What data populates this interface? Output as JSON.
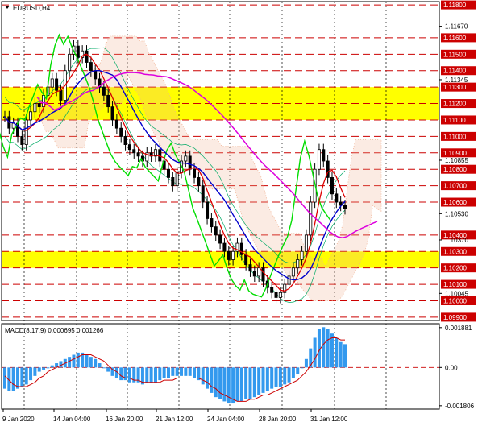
{
  "symbol_label": "EURUSD,H4",
  "macd_label": "MACD(8,17,9) 0.000695 0.001266",
  "colors": {
    "background": "#ffffff",
    "grid": "#000000",
    "price_bars": "#000000",
    "support_resistance": "#cc0000",
    "highlight_zone": "#ffff00",
    "ma_green": "#00dd00",
    "ma_blue": "#0000cc",
    "ma_red": "#dd0000",
    "ma_magenta": "#dd00dd",
    "envelope": "#00aa66",
    "cloud": "#f0b090",
    "macd_hist": "#3399ee",
    "macd_signal": "#cc0000",
    "label_bg": "#cc0000",
    "label_text": "#ffffff"
  },
  "chart_data": [
    {
      "type": "line",
      "title": "EURUSD,H4",
      "price_scale": [
        {
          "value": "1.11800",
          "boxed": true
        },
        {
          "value": "1.11670",
          "boxed": false
        },
        {
          "value": "1.11600",
          "boxed": true
        },
        {
          "value": "1.11500",
          "boxed": true
        },
        {
          "value": "1.11400",
          "boxed": true
        },
        {
          "value": "1.11345",
          "boxed": false
        },
        {
          "value": "1.11300",
          "boxed": true
        },
        {
          "value": "1.11200",
          "boxed": true
        },
        {
          "value": "1.11100",
          "boxed": true
        },
        {
          "value": "1.11000",
          "boxed": true
        },
        {
          "value": "1.10900",
          "boxed": true
        },
        {
          "value": "1.10855",
          "boxed": false
        },
        {
          "value": "1.10800",
          "boxed": true
        },
        {
          "value": "1.10700",
          "boxed": true
        },
        {
          "value": "1.10600",
          "boxed": true
        },
        {
          "value": "1.10530",
          "boxed": false
        },
        {
          "value": "1.10400",
          "boxed": true
        },
        {
          "value": "1.10370",
          "boxed": false
        },
        {
          "value": "1.10300",
          "boxed": true
        },
        {
          "value": "1.10200",
          "boxed": true
        },
        {
          "value": "1.10100",
          "boxed": true
        },
        {
          "value": "1.10045",
          "boxed": false
        },
        {
          "value": "1.10000",
          "boxed": true
        },
        {
          "value": "1.09900",
          "boxed": true
        }
      ],
      "ylim": [
        1.0988,
        1.1182
      ],
      "highlight_zones": [
        [
          1.111,
          1.113
        ],
        [
          1.102,
          1.103
        ]
      ],
      "x_categories": [
        "9 Jan 2020",
        "14 Jan 04:00",
        "16 Jan 20:00",
        "21 Jan 12:00",
        "24 Jan 04:00",
        "28 Jan 20:00",
        "31 Jan 12:00"
      ],
      "series": [
        {
          "values": [
            1.1112,
            1.1105,
            1.1108,
            1.11,
            1.1095,
            1.111,
            1.1115,
            1.112,
            1.1118,
            1.1125,
            1.113,
            1.1135,
            1.1128,
            1.1122,
            1.114,
            1.115,
            1.1155,
            1.1148,
            1.1152,
            1.1145,
            1.114,
            1.1135,
            1.113,
            1.1125,
            1.1118,
            1.111,
            1.1105,
            1.11,
            1.1095,
            1.1092,
            1.109,
            1.1088,
            1.1085,
            1.109,
            1.1088,
            1.1092,
            1.1085,
            1.108,
            1.1075,
            1.107,
            1.1078,
            1.1085,
            1.1088,
            1.108,
            1.1075,
            1.107,
            1.106,
            1.105,
            1.1045,
            1.104,
            1.1035,
            1.103,
            1.1025,
            1.103,
            1.1035,
            1.1028,
            1.1022,
            1.1018,
            1.1015,
            1.102,
            1.1012,
            1.1008,
            1.1005,
            1.1002,
            1.1005,
            1.101,
            1.1015,
            1.102,
            1.1025,
            1.103,
            1.104,
            1.106,
            1.108,
            1.1092,
            1.1085,
            1.1075,
            1.1065,
            1.106,
            1.1058,
            1.1056
          ]
        }
      ]
    },
    {
      "type": "bar",
      "title": "MACD(8,17,9) 0.000695 0.001266",
      "scale_labels": [
        "0.001881",
        "0.00",
        "-0.001806"
      ],
      "ylim": [
        -0.00185,
        0.00195
      ],
      "series": [
        {
          "values": [
            -0.001,
            -0.0011,
            -0.0011,
            -0.001,
            -0.0009,
            -0.0008,
            -0.0006,
            -0.0004,
            -0.0002,
            -0.0001,
            0.0,
            0.0001,
            0.0002,
            0.0003,
            0.0004,
            0.0005,
            0.0006,
            0.0007,
            0.0007,
            0.0006,
            0.0005,
            0.0004,
            0.0002,
            0.0,
            -0.0002,
            -0.0004,
            -0.0005,
            -0.0006,
            -0.0006,
            -0.0007,
            -0.0007,
            -0.0007,
            -0.0008,
            -0.0007,
            -0.0007,
            -0.0007,
            -0.0006,
            -0.0005,
            -0.0005,
            -0.0004,
            -0.0004,
            -0.0004,
            -0.0004,
            -0.0004,
            -0.0005,
            -0.0006,
            -0.0008,
            -0.001,
            -0.0012,
            -0.0014,
            -0.0015,
            -0.0016,
            -0.0017,
            -0.0017,
            -0.0016,
            -0.0016,
            -0.0015,
            -0.0015,
            -0.0014,
            -0.0013,
            -0.0012,
            -0.0011,
            -0.001,
            -0.0009,
            -0.0009,
            -0.0008,
            -0.0007,
            -0.0005,
            -0.0003,
            0.0,
            0.0004,
            0.0009,
            0.0014,
            0.0018,
            0.0019,
            0.0018,
            0.0016,
            0.0014,
            0.0012,
            0.0011
          ]
        },
        {
          "values": [
            -0.0004,
            -0.0006,
            -0.0008,
            -0.0009,
            -0.0009,
            -0.0009,
            -0.0008,
            -0.0007,
            -0.0005,
            -0.0004,
            -0.0002,
            -0.0001,
            0.0,
            0.0001,
            0.0002,
            0.0003,
            0.0004,
            0.0005,
            0.0006,
            0.0006,
            0.0006,
            0.0005,
            0.0004,
            0.0003,
            0.0001,
            -0.0001,
            -0.0002,
            -0.0004,
            -0.0005,
            -0.0005,
            -0.0006,
            -0.0006,
            -0.0007,
            -0.0007,
            -0.0007,
            -0.0007,
            -0.0007,
            -0.0006,
            -0.0006,
            -0.0006,
            -0.0005,
            -0.0005,
            -0.0005,
            -0.0005,
            -0.0005,
            -0.0005,
            -0.0006,
            -0.0007,
            -0.0009,
            -0.001,
            -0.0012,
            -0.0013,
            -0.0014,
            -0.0015,
            -0.0016,
            -0.0016,
            -0.0016,
            -0.0015,
            -0.0015,
            -0.0014,
            -0.0013,
            -0.0013,
            -0.0012,
            -0.0011,
            -0.001,
            -0.0009,
            -0.0008,
            -0.0007,
            -0.0006,
            -0.0004,
            -0.0002,
            0.0001,
            0.0004,
            0.0008,
            0.0011,
            0.0013,
            0.0014,
            0.0014,
            0.0013,
            0.0013
          ]
        }
      ]
    }
  ]
}
